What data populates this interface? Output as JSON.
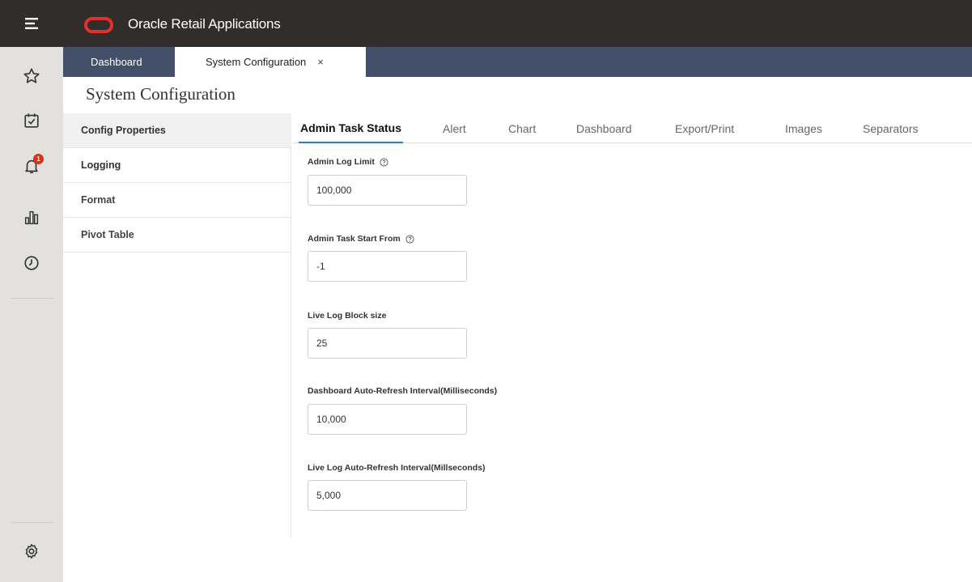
{
  "header": {
    "app_title": "Oracle Retail Applications",
    "colors": {
      "bar": "#312d2a",
      "logo": "#e4302c",
      "tabstrip": "#44506a",
      "rail": "#e3e1dd",
      "active_tab_underline": "#2c7fb8",
      "badge": "#d6341d"
    }
  },
  "rail": {
    "icons": [
      "hamburger-menu-icon",
      "star-icon",
      "calendar-check-icon",
      "bell-icon",
      "bar-chart-icon",
      "clock-icon",
      "gear-icon"
    ],
    "notification_count": "1"
  },
  "tabs": [
    {
      "label": "Dashboard"
    },
    {
      "label": "System Configuration",
      "close": "×"
    }
  ],
  "page": {
    "title": "System Configuration"
  },
  "config_nav": {
    "items": [
      {
        "label": "Config Properties"
      },
      {
        "label": "Logging"
      },
      {
        "label": "Format"
      },
      {
        "label": "Pivot Table"
      }
    ]
  },
  "subtabs": [
    {
      "label": "Admin Task Status"
    },
    {
      "label": "Alert"
    },
    {
      "label": "Chart"
    },
    {
      "label": "Dashboard"
    },
    {
      "label": "Export/Print"
    },
    {
      "label": "Images"
    },
    {
      "label": "Separators"
    }
  ],
  "form": {
    "fields": [
      {
        "label": "Admin Log Limit",
        "value": "100,000",
        "help_icon": "help-icon"
      },
      {
        "label": "Admin Task Start From",
        "value": "-1",
        "help_icon": "help-icon"
      },
      {
        "label": "Live Log Block size",
        "value": "25"
      },
      {
        "label": "Dashboard Auto-Refresh Interval(Milliseconds)",
        "value": "10,000"
      },
      {
        "label": "Live Log Auto-Refresh Interval(Millseconds)",
        "value": "5,000"
      }
    ]
  }
}
